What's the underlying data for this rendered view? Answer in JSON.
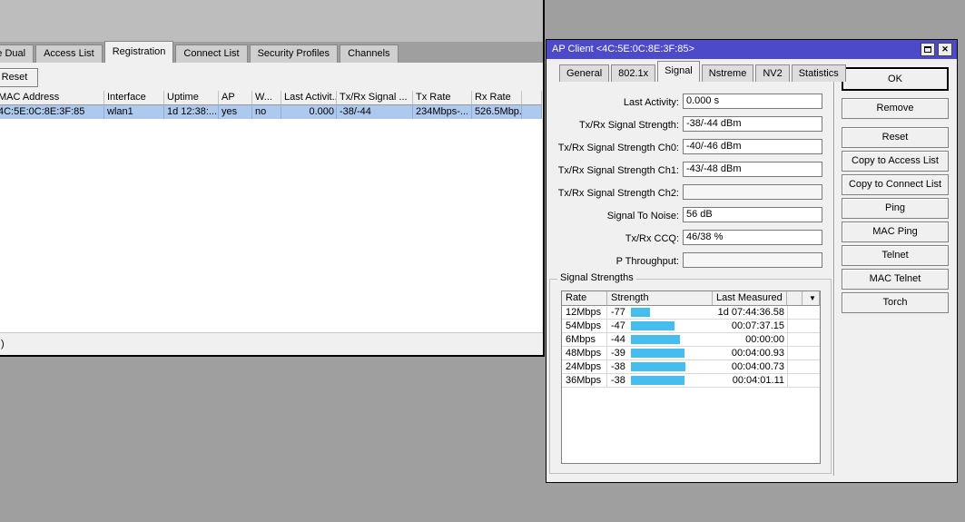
{
  "colors": {
    "titlebar": "#4c4ac8",
    "selection": "#adc9ee",
    "bar": "#45bdee",
    "desktop": "#9f9f9f"
  },
  "main_window": {
    "tabs": [
      "eme Dual",
      "Access List",
      "Registration",
      "Connect List",
      "Security Profiles",
      "Channels"
    ],
    "active_tab": "Registration",
    "toolbar": {
      "reset_label": "Reset"
    },
    "table": {
      "columns": [
        "MAC Address",
        "Interface",
        "Uptime",
        "AP",
        "W...",
        "Last Activit...",
        "Tx/Rx Signal ...",
        "Tx Rate",
        "Rx Rate",
        ""
      ],
      "row": [
        "4C:5E:0C:8E:3F:85",
        "wlan1",
        "1d 12:38:...",
        "yes",
        "no",
        "0.000",
        "-38/-44",
        "234Mbps-...",
        "526.5Mbp...",
        ""
      ]
    },
    "statusbar": {
      "text": ")"
    }
  },
  "dialog": {
    "title": "AP Client <4C:5E:0C:8E:3F:85>",
    "icons": {
      "close_glyph": "✕",
      "dropdown_glyph": "▼"
    },
    "tabs": [
      "General",
      "802.1x",
      "Signal",
      "Nstreme",
      "NV2",
      "Statistics"
    ],
    "active_tab": "Signal",
    "fields": [
      {
        "label": "Last Activity:",
        "value": "0.000 s"
      },
      {
        "label": "Tx/Rx Signal Strength:",
        "value": "-38/-44 dBm"
      },
      {
        "label": "Tx/Rx Signal Strength Ch0:",
        "value": "-40/-46 dBm"
      },
      {
        "label": "Tx/Rx Signal Strength Ch1:",
        "value": "-43/-48 dBm"
      },
      {
        "label": "Tx/Rx Signal Strength Ch2:",
        "value": ""
      },
      {
        "label": "Signal To Noise:",
        "value": "56 dB"
      },
      {
        "label": "Tx/Rx CCQ:",
        "value": "46/38 %"
      },
      {
        "label": "P Throughput:",
        "value": ""
      }
    ],
    "group": {
      "label": "Signal Strengths"
    },
    "signal_table": {
      "columns": [
        "Rate",
        "Strength",
        "Last Measured"
      ],
      "rows": [
        {
          "rate": "12Mbps",
          "strength": "-77",
          "bar": 21,
          "last": "1d 07:44:36.58"
        },
        {
          "rate": "54Mbps",
          "strength": "-47",
          "bar": 48,
          "last": "00:07:37.15"
        },
        {
          "rate": "6Mbps",
          "strength": "-44",
          "bar": 54,
          "last": "00:00:00"
        },
        {
          "rate": "48Mbps",
          "strength": "-39",
          "bar": 59,
          "last": "00:04:00.93"
        },
        {
          "rate": "24Mbps",
          "strength": "-38",
          "bar": 60,
          "last": "00:04:00.73"
        },
        {
          "rate": "36Mbps",
          "strength": "-38",
          "bar": 59,
          "last": "00:04:01.11"
        }
      ]
    },
    "buttons": [
      "OK",
      "Remove",
      "Reset",
      "Copy to Access List",
      "Copy to Connect List",
      "Ping",
      "MAC Ping",
      "Telnet",
      "MAC Telnet",
      "Torch"
    ]
  }
}
